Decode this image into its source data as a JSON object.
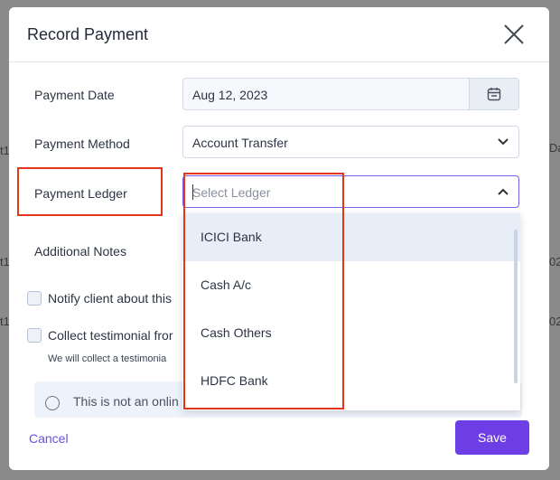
{
  "background": {
    "fragments": [
      "t1",
      "t1",
      "t1",
      "Da",
      "02",
      "02"
    ]
  },
  "modal": {
    "title": "Record Payment",
    "close_icon": "close-icon"
  },
  "form": {
    "payment_date": {
      "label": "Payment Date",
      "value": "Aug 12, 2023",
      "icon": "calendar-icon"
    },
    "payment_method": {
      "label": "Payment Method",
      "value": "Account Transfer",
      "icon": "chevron-down-icon"
    },
    "payment_ledger": {
      "label": "Payment Ledger",
      "placeholder": "Select Ledger",
      "icon": "chevron-up-icon"
    },
    "additional_notes": {
      "label": "Additional Notes"
    },
    "notify_client": {
      "label": "Notify client about this"
    },
    "collect_testimonial": {
      "label": "Collect testimonial fror",
      "hint": "We will collect a testimonia"
    },
    "info": {
      "text": "This is not an onlin",
      "icon": "info-icon"
    }
  },
  "ledger_options": [
    {
      "label": "ICICI Bank",
      "highlighted": true
    },
    {
      "label": "Cash A/c",
      "highlighted": false
    },
    {
      "label": "Cash Others",
      "highlighted": false
    },
    {
      "label": "HDFC Bank",
      "highlighted": false
    }
  ],
  "footer": {
    "cancel_label": "Cancel",
    "save_label": "Save"
  },
  "colors": {
    "accent": "#6d3ee6",
    "highlight_box": "#e2361b",
    "selected_option_bg": "#e8eef8"
  }
}
